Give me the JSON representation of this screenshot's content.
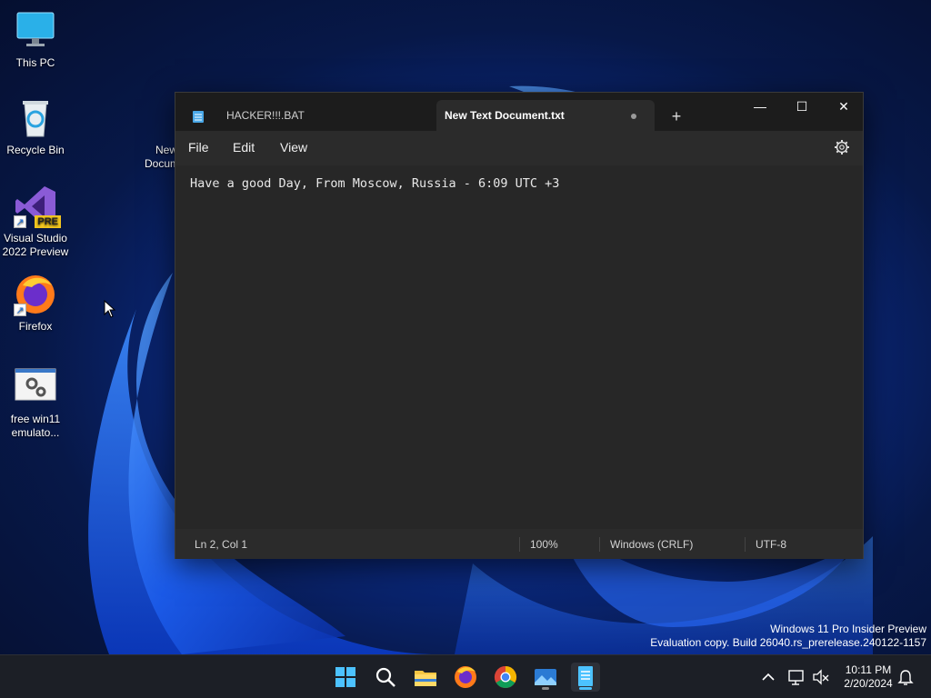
{
  "desktop": {
    "icons": [
      {
        "label": "This PC"
      },
      {
        "label": "Recycle Bin"
      },
      {
        "label": "Visual Studio\n2022 Preview",
        "line1": "Visual Studio",
        "line2": "2022 Preview",
        "badge": "PRE"
      },
      {
        "label": "Firefox"
      },
      {
        "label": "free win11 emulato...",
        "line1": "free win11",
        "line2": "emulato..."
      },
      {
        "label": "New Text Document",
        "line1": "New",
        "line2": "Docum"
      }
    ],
    "watermark": {
      "line1": "Windows 11 Pro Insider Preview",
      "line2": "Evaluation copy. Build 26040.rs_prerelease.240122-1157"
    }
  },
  "notepad": {
    "tabs": [
      {
        "label": "HACKER!!!.BAT",
        "active": false
      },
      {
        "label": "New Text Document.txt",
        "active": true,
        "unsaved": true
      }
    ],
    "new_tab_glyph": "+",
    "window_controls": {
      "minimize": "—",
      "maximize": "☐",
      "close": "✕"
    },
    "menu": [
      "File",
      "Edit",
      "View"
    ],
    "content": "Have a good Day, From Moscow, Russia - 6:09 UTC +3",
    "status": {
      "position": "Ln 2, Col 1",
      "zoom": "100%",
      "line_ending": "Windows (CRLF)",
      "encoding": "UTF-8"
    }
  },
  "taskbar": {
    "apps": [
      "start-icon",
      "search-icon",
      "file-explorer-icon",
      "firefox-icon",
      "chrome-icon",
      "photos-icon",
      "notepad-icon"
    ],
    "clock": {
      "time": "10:11 PM",
      "date": "2/20/2024"
    },
    "tray": [
      "chevron-up-icon",
      "network-icon",
      "volume-muted-icon",
      "notification-bell-icon"
    ]
  },
  "colors": {
    "accent": "#4cc2ff",
    "window_bg": "#202020",
    "editor_bg": "#272727",
    "taskbar_bg": "#1c1f26"
  }
}
